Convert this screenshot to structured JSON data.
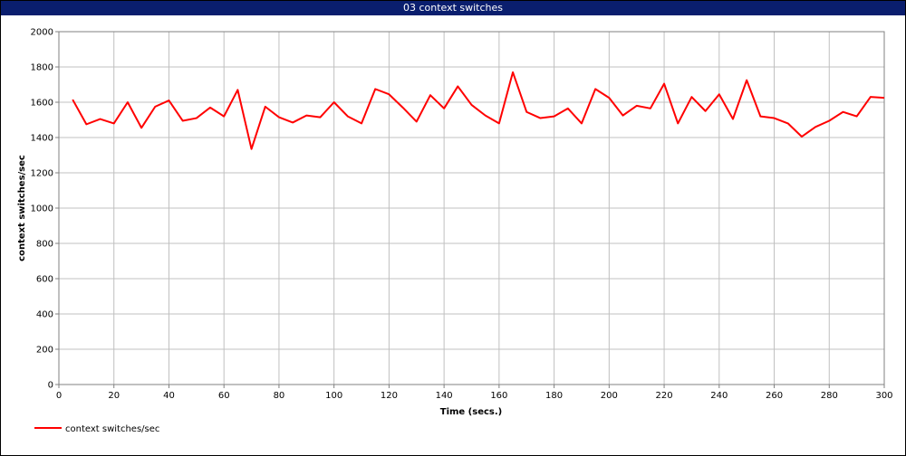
{
  "window": {
    "title": "03 context switches"
  },
  "chart_data": {
    "type": "line",
    "title": "03 context switches",
    "xlabel": "Time (secs.)",
    "ylabel": "context switches/sec",
    "xlim": [
      0,
      300
    ],
    "ylim": [
      0,
      2000
    ],
    "x_ticks": [
      0,
      20,
      40,
      60,
      80,
      100,
      120,
      140,
      160,
      180,
      200,
      220,
      240,
      260,
      280,
      300
    ],
    "y_ticks": [
      0,
      200,
      400,
      600,
      800,
      1000,
      1200,
      1400,
      1600,
      1800,
      2000
    ],
    "grid": true,
    "legend_position": "bottom-left",
    "series": [
      {
        "name": "context switches/sec",
        "color": "#ff0000",
        "x": [
          5,
          10,
          15,
          20,
          25,
          30,
          35,
          40,
          45,
          50,
          55,
          60,
          65,
          70,
          75,
          80,
          85,
          90,
          95,
          100,
          105,
          110,
          115,
          120,
          125,
          130,
          135,
          140,
          145,
          150,
          155,
          160,
          165,
          170,
          175,
          180,
          185,
          190,
          195,
          200,
          205,
          210,
          215,
          220,
          225,
          230,
          235,
          240,
          245,
          250,
          255,
          260,
          265,
          270,
          275,
          280,
          285,
          290,
          295,
          300
        ],
        "y": [
          1615,
          1475,
          1505,
          1480,
          1600,
          1455,
          1575,
          1610,
          1495,
          1510,
          1570,
          1520,
          1670,
          1335,
          1575,
          1515,
          1485,
          1525,
          1515,
          1600,
          1520,
          1480,
          1675,
          1645,
          1570,
          1490,
          1640,
          1565,
          1690,
          1585,
          1525,
          1480,
          1770,
          1545,
          1510,
          1520,
          1565,
          1480,
          1675,
          1625,
          1525,
          1580,
          1565,
          1705,
          1480,
          1630,
          1550,
          1645,
          1505,
          1725,
          1520,
          1510,
          1480,
          1405,
          1460,
          1495,
          1545,
          1520,
          1630,
          1625
        ]
      }
    ]
  }
}
